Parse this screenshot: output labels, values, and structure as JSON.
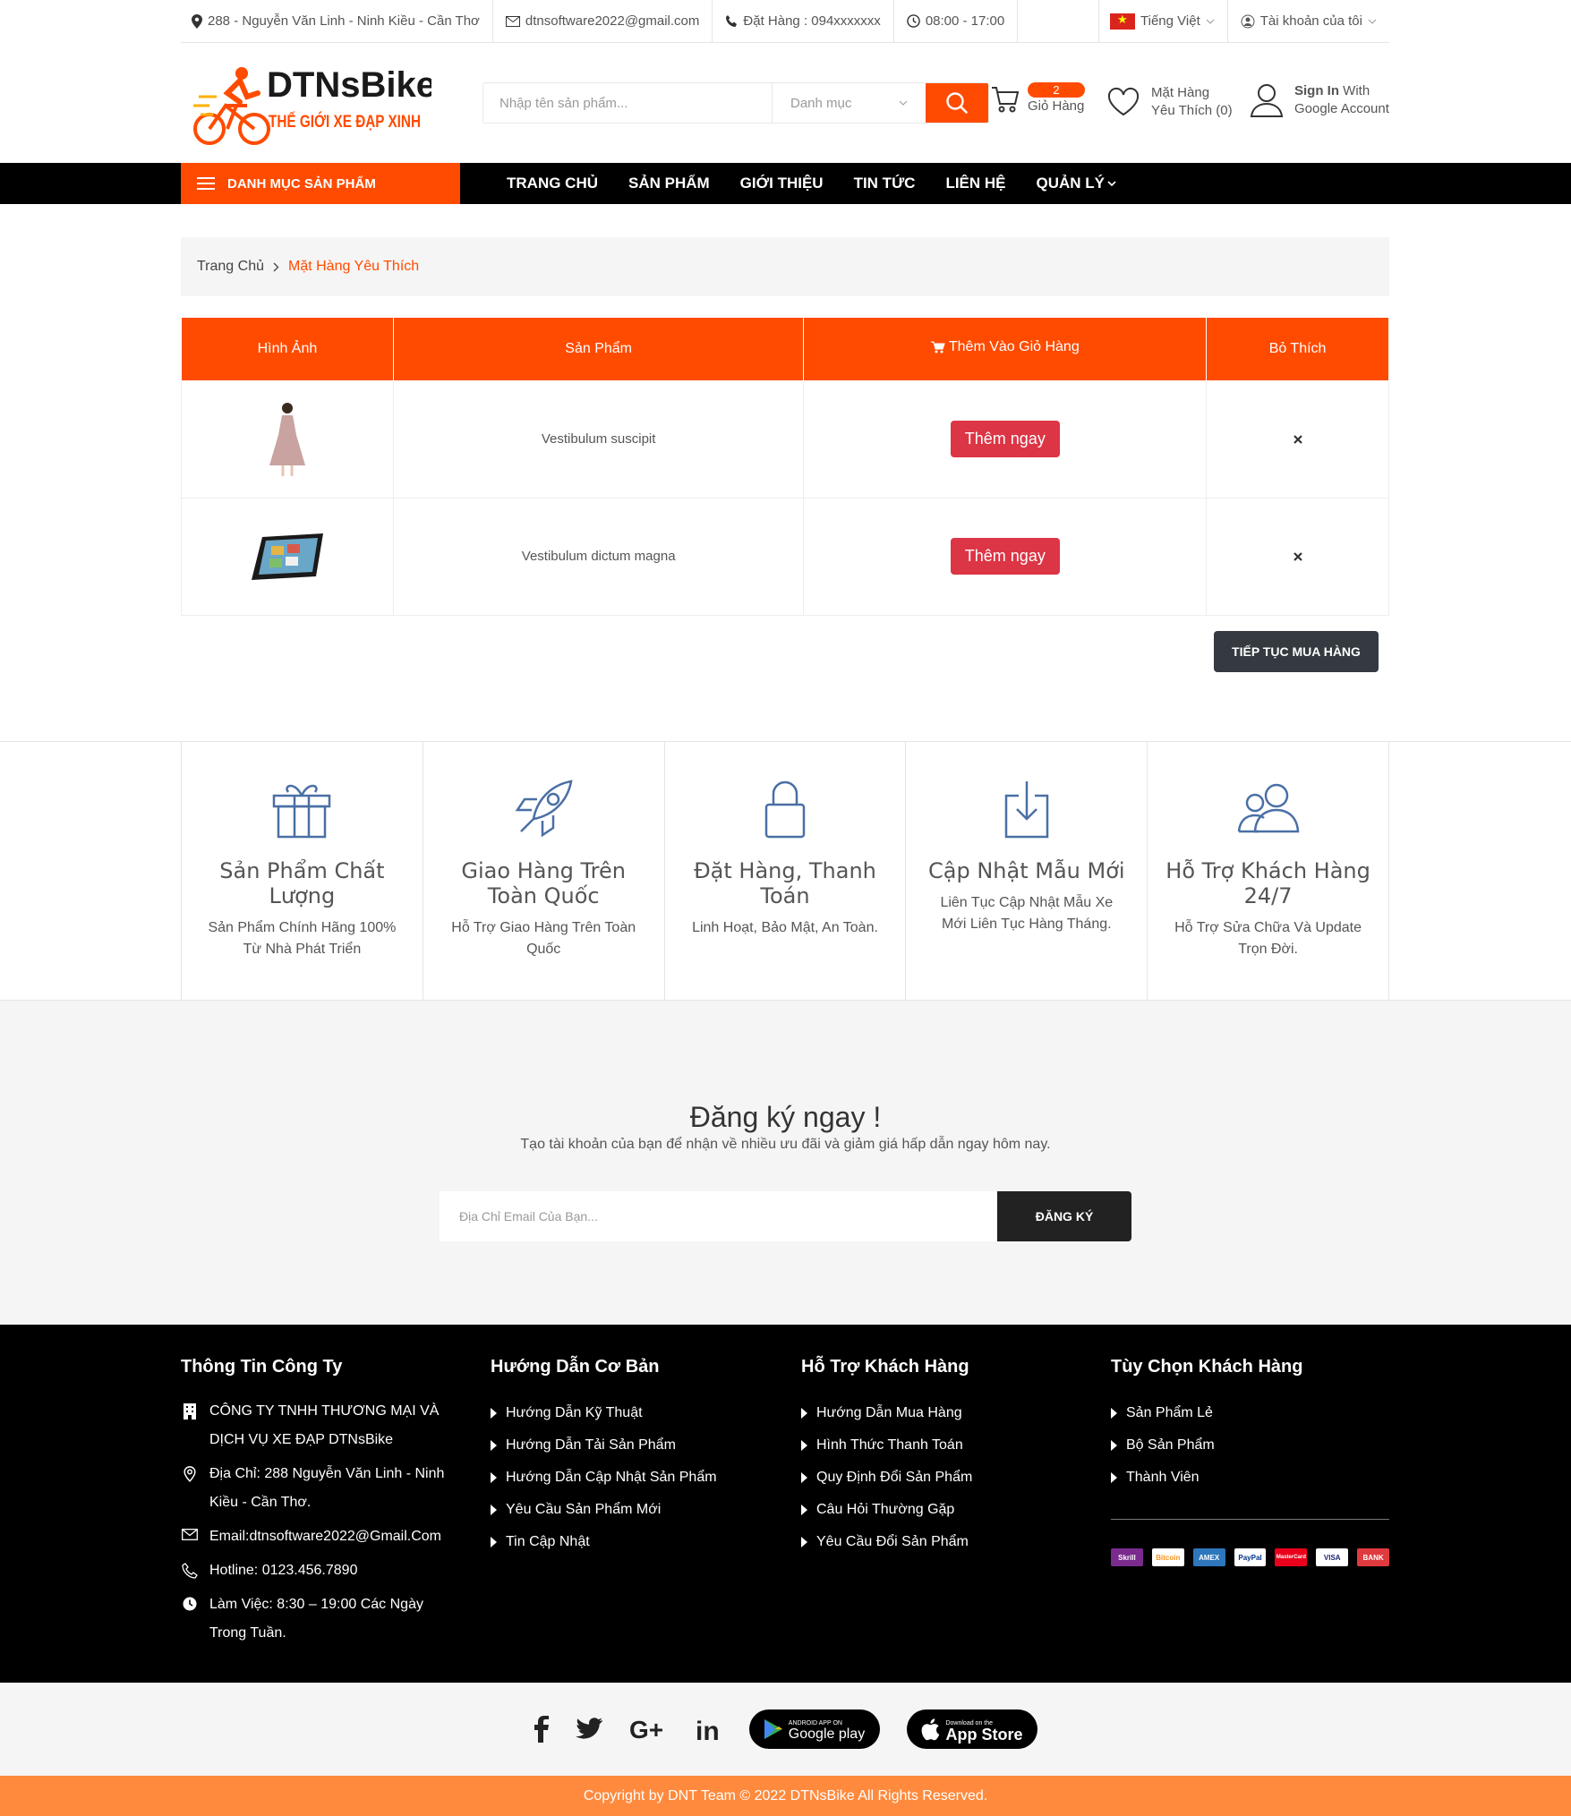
{
  "topbar": {
    "address": "288 - Nguyễn Văn Linh - Ninh Kiều - Cần Thơ",
    "email": "dtnsoftware2022@gmail.com",
    "phone": "Đặt Hàng : 094xxxxxxx",
    "hours": "08:00 - 17:00",
    "language": "Tiếng Việt",
    "account": "Tài khoản của tôi"
  },
  "logo": {
    "name": "DTNsBike",
    "tagline": "THẾ GIỚI XE ĐẠP XINH"
  },
  "search": {
    "placeholder": "Nhập tên sản phẩm...",
    "category": "Danh mục"
  },
  "cart": {
    "count": "2",
    "label": "Giỏ Hàng"
  },
  "wishlist": {
    "line1": "Mặt Hàng",
    "line2": "Yêu Thích (0)"
  },
  "account": {
    "line1_bold": "Sign In",
    "line1_rest": " With",
    "line2": "Google Account"
  },
  "nav": {
    "category": "DANH MỤC SẢN PHẨM",
    "items": [
      "TRANG CHỦ",
      "SẢN PHẨM",
      "GIỚI THIỆU",
      "TIN TỨC",
      "LIÊN HỆ",
      "QUẢN LÝ"
    ]
  },
  "breadcrumb": {
    "home": "Trang Chủ",
    "current": "Mặt Hàng Yêu Thích"
  },
  "table": {
    "headers": [
      "Hình Ảnh",
      "Sản Phẩm",
      "Thêm Vào Giỏ Hàng",
      "Bỏ Thích"
    ],
    "rows": [
      {
        "product": "Vestibulum suscipit",
        "action": "Thêm ngay"
      },
      {
        "product": "Vestibulum dictum magna",
        "action": "Thêm ngay"
      }
    ],
    "continue": "TIẾP TỤC MUA HÀNG"
  },
  "features": [
    {
      "icon": "gift-icon",
      "title": "Sản Phẩm Chất Lượng",
      "desc": "Sản Phẩm Chính Hãng 100% Từ Nhà Phát Triển"
    },
    {
      "icon": "rocket-icon",
      "title": "Giao Hàng Trên Toàn Quốc",
      "desc": "Hỗ Trợ Giao Hàng Trên Toàn Quốc"
    },
    {
      "icon": "lock-icon",
      "title": "Đặt Hàng, Thanh Toán",
      "desc": "Linh Hoạt, Bảo Mật, An Toàn."
    },
    {
      "icon": "download-icon",
      "title": "Cập Nhật Mẫu Mới",
      "desc": "Liên Tục Cập Nhật Mẫu Xe Mới Liên Tục Hàng Tháng."
    },
    {
      "icon": "users-icon",
      "title": "Hỗ Trợ Khách Hàng 24/7",
      "desc": "Hỗ Trợ Sửa Chữa Và Update Trọn Đời."
    }
  ],
  "signup": {
    "title": "Đăng ký ngay !",
    "desc": "Tạo tài khoản của bạn để nhận về nhiều ưu đãi và giảm giá hấp dẫn ngay hôm nay.",
    "placeholder": "Địa Chỉ Email Của Bạn...",
    "button": "ĐĂNG KÝ"
  },
  "footer": {
    "col1": {
      "title": "Thông Tin Công Ty",
      "company": "CÔNG TY TNHH THƯƠNG MẠI VÀ DỊCH VỤ XE ĐẠP DTNsBike",
      "address": "Địa Chỉ: 288 Nguyễn Văn Linh - Ninh Kiều - Cần Thơ.",
      "email": "Email:dtnsoftware2022@Gmail.Com",
      "hotline": "Hotline: 0123.456.7890",
      "hours": "Làm Việc: 8:30 – 19:00 Các Ngày Trong Tuần."
    },
    "col2": {
      "title": "Hướng Dẫn Cơ Bản",
      "links": [
        "Hướng Dẫn Kỹ Thuật",
        "Hướng Dẫn Tải Sản Phẩm",
        "Hướng Dẫn Cập Nhật Sản Phẩm",
        "Yêu Cầu Sản Phẩm Mới",
        "Tin Cập Nhật"
      ]
    },
    "col3": {
      "title": "Hỗ Trợ Khách Hàng",
      "links": [
        "Hướng Dẫn Mua Hàng",
        "Hình Thức Thanh Toán",
        "Quy Định Đổi Sản Phẩm",
        "Câu Hỏi Thường Gặp",
        "Yêu Cầu Đổi Sản Phẩm"
      ]
    },
    "col4": {
      "title": "Tùy Chọn Khách Hàng",
      "links": [
        "Sản Phẩm Lẻ",
        "Bộ Sản Phẩm",
        "Thành Viên"
      ]
    },
    "payments": [
      "Skrill",
      "Bitcoin",
      "AMEX",
      "PayPal",
      "MasterCard",
      "VISA",
      "BANK"
    ]
  },
  "stores": {
    "google_small": "ANDROID APP ON",
    "google": "Google play",
    "apple_small": "Download on the",
    "apple": "App Store"
  },
  "copyright": "Copyright by DNT Team © 2022 DTNsBike All Rights Reserved.",
  "colors": {
    "accent": "#ff4b00",
    "danger": "#dc3545",
    "footer": "#000000",
    "copyright_bar": "#ff8a3d"
  }
}
